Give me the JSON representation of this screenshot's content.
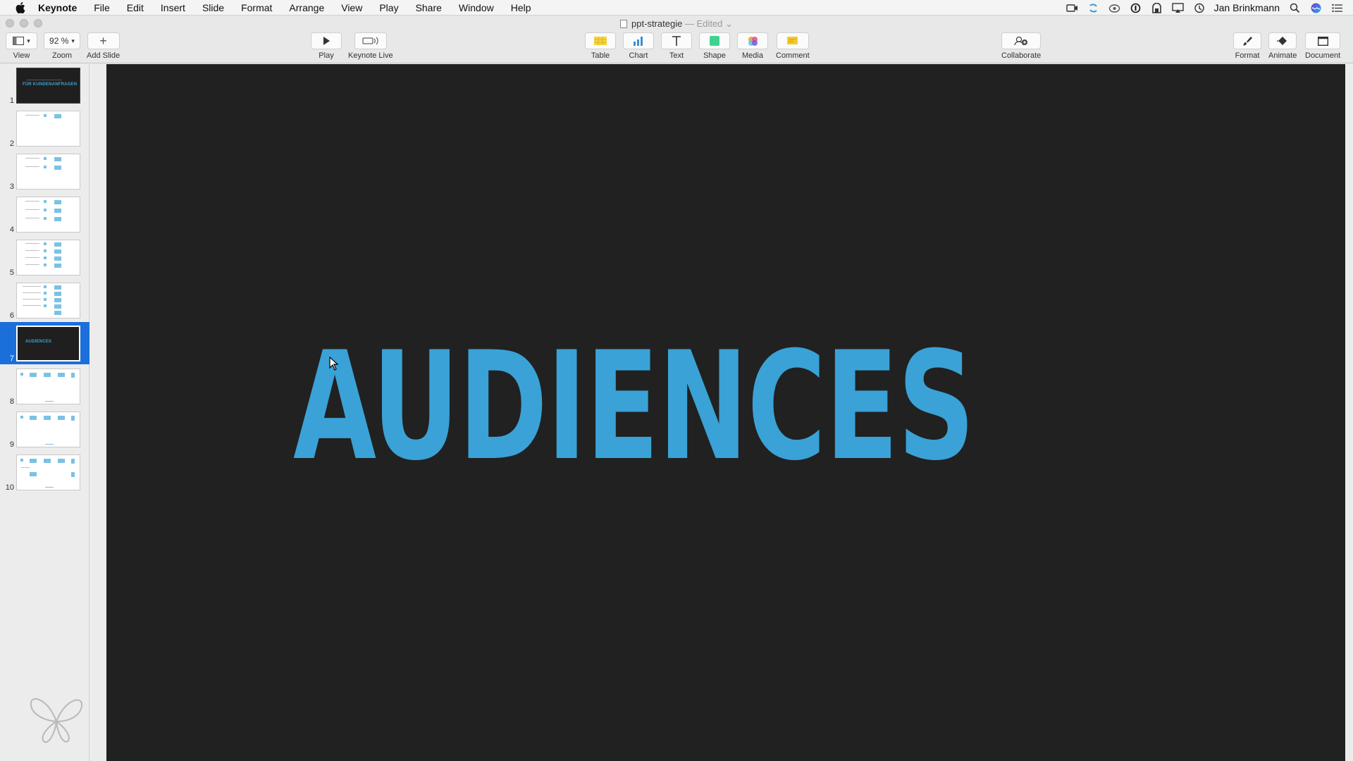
{
  "menubar": {
    "app_name": "Keynote",
    "items": [
      "File",
      "Edit",
      "Insert",
      "Slide",
      "Format",
      "Arrange",
      "View",
      "Play",
      "Share",
      "Window",
      "Help"
    ],
    "user": "Jan Brinkmann",
    "status_icons": [
      "screen-record-icon",
      "sync-icon",
      "cloud-icon",
      "password-icon",
      "backup-icon",
      "airplay-icon",
      "time-machine-icon",
      "spotlight-icon",
      "siri-icon",
      "notification-center-icon"
    ]
  },
  "window": {
    "title": "ppt-strategie",
    "edited": "— Edited"
  },
  "toolbar": {
    "view_label": "View",
    "zoom_value": "92 %",
    "zoom_label": "Zoom",
    "add_slide_label": "Add Slide",
    "play_label": "Play",
    "keynote_live_label": "Keynote Live",
    "table_label": "Table",
    "chart_label": "Chart",
    "text_label": "Text",
    "shape_label": "Shape",
    "media_label": "Media",
    "comment_label": "Comment",
    "collaborate_label": "Collaborate",
    "format_label": "Format",
    "animate_label": "Animate",
    "document_label": "Document"
  },
  "navigator": {
    "slides": [
      {
        "number": "1",
        "style": "dark",
        "thumb_text": "FÜR KUNDENANFRAGEN"
      },
      {
        "number": "2",
        "style": "light"
      },
      {
        "number": "3",
        "style": "light"
      },
      {
        "number": "4",
        "style": "light"
      },
      {
        "number": "5",
        "style": "light"
      },
      {
        "number": "6",
        "style": "light"
      },
      {
        "number": "7",
        "style": "dark",
        "thumb_text": "AUDIENCES",
        "selected": true
      },
      {
        "number": "8",
        "style": "light"
      },
      {
        "number": "9",
        "style": "light"
      },
      {
        "number": "10",
        "style": "light"
      }
    ]
  },
  "slide": {
    "title": "AUDIENCES",
    "background": "#212121",
    "title_color": "#3aa2d6"
  },
  "colors": {
    "accent": "#3aa2d6",
    "selection": "#1a6fdb"
  }
}
